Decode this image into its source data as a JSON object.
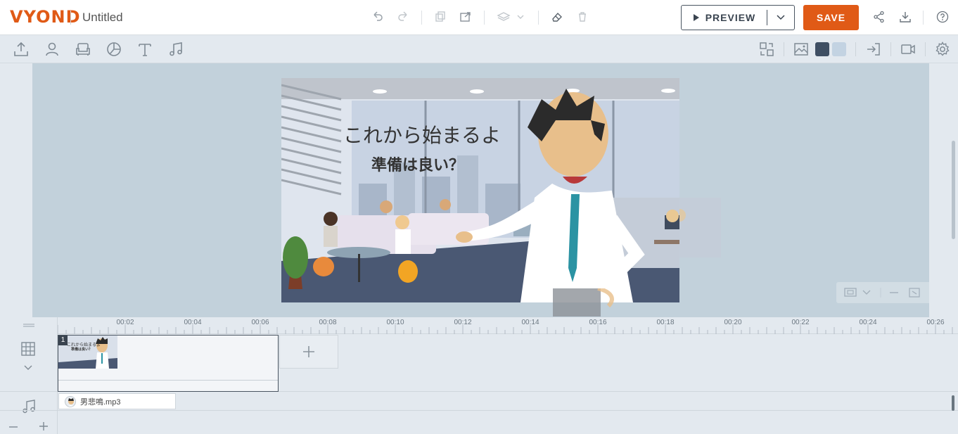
{
  "app": {
    "logo": "VYOND",
    "title": "Untitled"
  },
  "topbar": {
    "preview_label": "PREVIEW",
    "save_label": "SAVE"
  },
  "colors": {
    "accent": "#e05a16",
    "swatch_dark": "#3f4f63",
    "swatch_light": "#c3d3e2",
    "stage_bg": "#c2d1db"
  },
  "icons": {
    "undo": "undo-icon",
    "redo": "redo-icon",
    "copy": "copy-icon",
    "paste": "paste-icon",
    "layers": "layers-icon",
    "clear": "eraser-icon",
    "delete": "trash-icon",
    "share": "share-icon",
    "download": "download-icon",
    "help": "help-icon",
    "upload": "upload-icon",
    "character": "character-icon",
    "props": "sofa-icon",
    "charts": "chart-icon",
    "text": "text-icon",
    "audio": "music-icon",
    "swap": "swap-icon",
    "background": "image-icon",
    "enter": "enter-icon",
    "camera": "camera-icon",
    "settings": "gear-icon"
  },
  "scene": {
    "line1": "これから始まるよ",
    "line2": "準備は良い？"
  },
  "timeline": {
    "ticks": [
      "00:02",
      "00:04",
      "00:06",
      "00:08",
      "00:10",
      "00:12",
      "00:14",
      "00:16",
      "00:18",
      "00:20",
      "00:22",
      "00:24",
      "00:26"
    ],
    "scene_number": "1",
    "thumb_text1": "これから始まるよ",
    "thumb_text2": "準備は良い？",
    "audio_file": "男悲鳴.mp3"
  }
}
